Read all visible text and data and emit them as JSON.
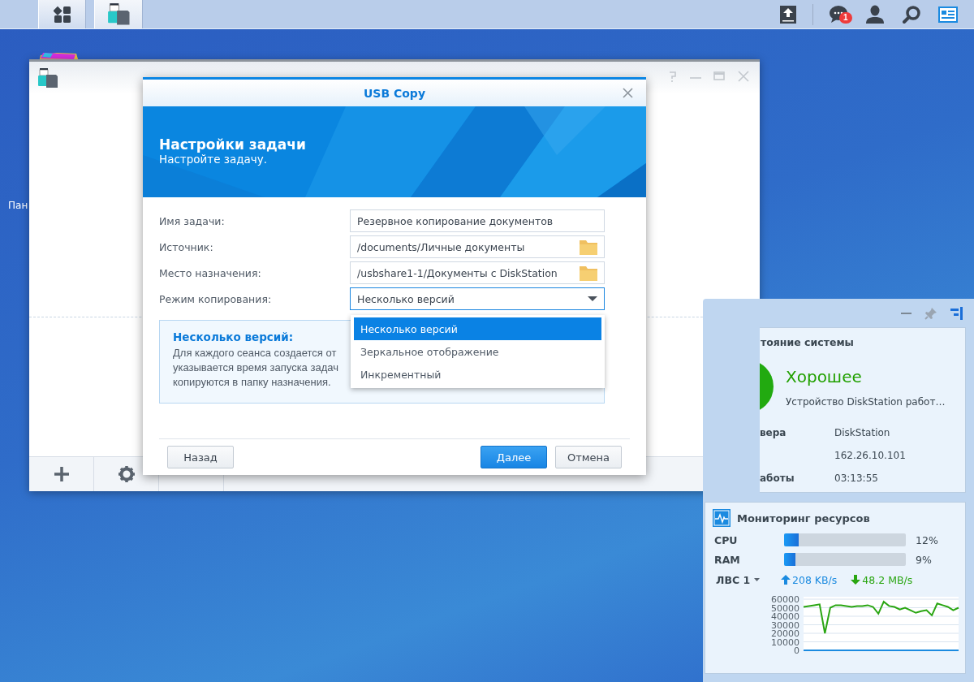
{
  "taskbar": {
    "notification_badge": "1"
  },
  "desktop_labels": [
    "Пан"
  ],
  "dialog": {
    "title": "USB Copy",
    "heading": "Настройки задачи",
    "subheading": "Настройте задачу.",
    "fields": [
      {
        "label": "Имя задачи:",
        "kind": "text",
        "value": "Резервное копирование документов"
      },
      {
        "label": "Источник:",
        "kind": "folder",
        "value": "/documents/Личные документы"
      },
      {
        "label": "Место назначения:",
        "kind": "folder",
        "value": "/usbshare1-1/Документы с DiskStation"
      },
      {
        "label": "Режим копирования:",
        "kind": "select",
        "value": "Несколько версий",
        "expanded": true
      }
    ],
    "dropdown_options": [
      {
        "label": "Несколько версий",
        "selected": true
      },
      {
        "label": "Зеркальное отображение",
        "selected": false
      },
      {
        "label": "Инкрементный",
        "selected": false
      }
    ],
    "info": {
      "title": "Несколько версий:",
      "lines": [
        "Для каждого сеанса создается от",
        "указывается время запуска задач",
        "копируются в папку назначения."
      ]
    },
    "buttons": [
      {
        "label": "Назад",
        "kind": "secondary"
      },
      {
        "label": "Далее",
        "kind": "primary"
      },
      {
        "label": "Отмена",
        "kind": "secondary"
      }
    ]
  },
  "status_widget": {
    "title": "тояние системы",
    "status": "Хорошее",
    "description": "Устройство DiskStation работ…",
    "rows": [
      {
        "label": "вера",
        "value": "DiskStation"
      },
      {
        "label": "",
        "value": "162.26.10.101"
      },
      {
        "label": "аботы",
        "value": "03:13:55"
      }
    ]
  },
  "resource_monitor": {
    "title": "Мониторинг ресурсов",
    "meters": [
      {
        "name": "CPU",
        "level": 0.12,
        "reading": "12%"
      },
      {
        "name": "RAM",
        "level": 0.09,
        "reading": "9%"
      }
    ],
    "network": {
      "interface": "ЛВС 1",
      "upload": "208 KB/s",
      "download": "48.2 MB/s"
    },
    "chart_data": {
      "type": "line",
      "grid": true,
      "ylim": [
        0,
        60000
      ],
      "yticks": [
        0,
        10000,
        20000,
        30000,
        40000,
        50000,
        60000
      ],
      "series": [
        {
          "color": "#2aa612",
          "values": [
            51000,
            52000,
            53000,
            54000,
            20000,
            50000,
            53000,
            53000,
            52000,
            51000,
            52000,
            52000,
            53000,
            51000,
            43000,
            57000,
            52000,
            51000,
            48000,
            50000,
            47000,
            44000,
            46000,
            47000,
            41000,
            55000,
            53000,
            51000,
            47000,
            50000
          ]
        },
        {
          "color": "#1a8ae0",
          "values": [
            0,
            0,
            0,
            0,
            0,
            0,
            0,
            0,
            0,
            0,
            0,
            0,
            0,
            0,
            0,
            0,
            0,
            0,
            0,
            0,
            0,
            0,
            0,
            0,
            0,
            0,
            0,
            0,
            0,
            0
          ]
        }
      ]
    }
  }
}
